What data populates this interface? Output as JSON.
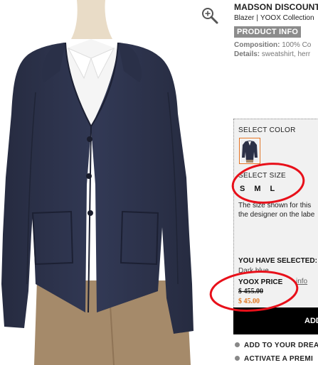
{
  "product": {
    "brand": "MADSON DISCOUNT",
    "category": "Blazer",
    "separator": "|",
    "collection": "YOOX Collection",
    "info_button": "PRODUCT INFO",
    "composition_label": "Composition:",
    "composition_value": "100% Co",
    "details_label": "Details:",
    "details_value": "sweatshirt, herr"
  },
  "selection": {
    "color_label": "SELECT COLOR",
    "size_label": "SELECT SIZE",
    "sizes": [
      "S",
      "M",
      "L"
    ],
    "size_note_line1": "The size shown for this",
    "size_note_line2": "the designer on the labe",
    "selected_label": "YOU HAVE SELECTED:",
    "selected_value": "Dark blue"
  },
  "price": {
    "label": "YOOX PRICE",
    "info_link": "info",
    "original": "$ 455.00",
    "discounted": "$ 45.00"
  },
  "actions": {
    "add_button": "ADD",
    "dream_link": "ADD TO YOUR DREA",
    "premium_link": "ACTIVATE A PREMI"
  },
  "icons": {
    "zoom": "zoom-in-icon"
  },
  "colors": {
    "annotation": "#e8101a",
    "sale_price": "#e0731a",
    "swatch_border": "#e07020",
    "jacket": "#2b3148"
  }
}
